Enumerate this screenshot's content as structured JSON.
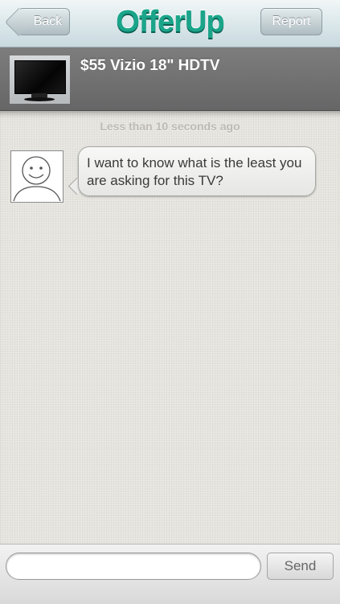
{
  "navbar": {
    "back_label": "Back",
    "logo_text": "OfferUp",
    "report_label": "Report"
  },
  "item": {
    "title": "$55 Vizio 18\" HDTV",
    "thumbnail_icon": "tv-thumbnail"
  },
  "chat": {
    "timestamp": "Less than 10 seconds ago",
    "messages": [
      {
        "avatar_icon": "smiley-avatar-icon",
        "text": "I want to know what is the least you are asking for this TV?"
      }
    ]
  },
  "compose": {
    "input_value": "",
    "input_placeholder": "",
    "send_label": "Send"
  },
  "colors": {
    "brand": "#1aa58a",
    "header_bg": "#6f6f6f"
  }
}
